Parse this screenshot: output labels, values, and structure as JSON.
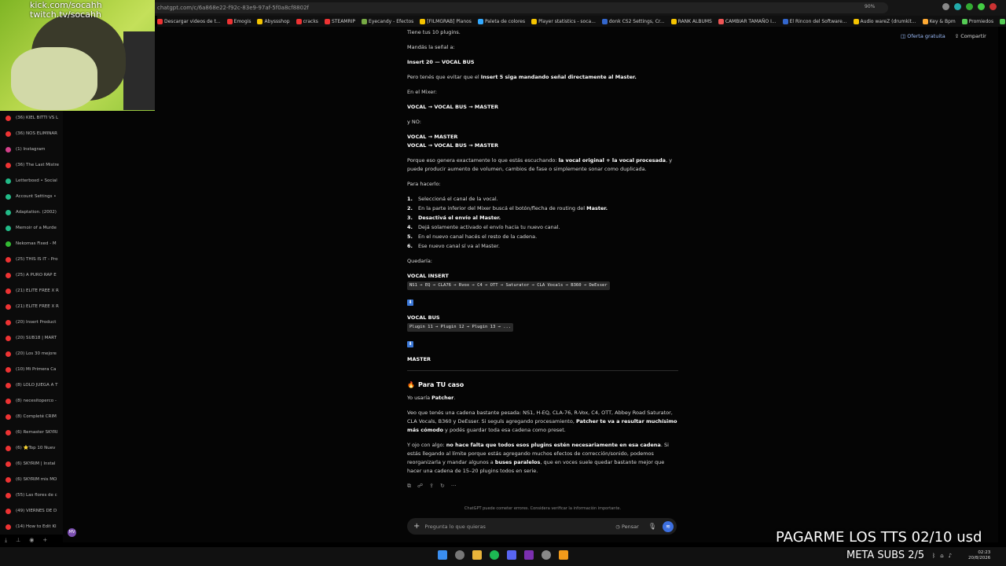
{
  "browser": {
    "url": "chatgpt.com/c/6a868e22-f92c-83e9-97af-5f0a8cf8802f",
    "zoom": "90%",
    "bookmarks": [
      {
        "label": "Descargar videos de t...",
        "color": "#e33"
      },
      {
        "label": "Emogis",
        "color": "#e33"
      },
      {
        "label": "Abyssshop",
        "color": "#f5c400"
      },
      {
        "label": "cracks",
        "color": "#e33"
      },
      {
        "label": "STEAMRIP",
        "color": "#e33"
      },
      {
        "label": "Eyecandy - Efectos",
        "color": "#7a4"
      },
      {
        "label": "[FILMGRAB] Planos",
        "color": "#f5c400"
      },
      {
        "label": "Paleta de colores",
        "color": "#3af"
      },
      {
        "label": "Player statistics - soca...",
        "color": "#f5c400"
      },
      {
        "label": "donk CS2 Settings, Cr...",
        "color": "#36c"
      },
      {
        "label": "RANK ALBUMS",
        "color": "#f5c400"
      },
      {
        "label": "CAMBIAR TAMAÑO I...",
        "color": "#e55"
      },
      {
        "label": "El Rincon del Software...",
        "color": "#36c"
      },
      {
        "label": "Audio wareZ (drumkit...",
        "color": "#f5c400"
      },
      {
        "label": "Key & Bpm",
        "color": "#fa3"
      },
      {
        "label": "Promiedos",
        "color": "#5c5"
      },
      {
        "label": "botkick",
        "color": "#5c5"
      },
      {
        "label": "CRACKS VSTS",
        "color": "#f5c400"
      }
    ]
  },
  "stream": {
    "kick": "kick.com/socahh",
    "twitch": "twitch.tv/socahh",
    "overlay_tts": "PAGARME LOS TTS 02/10 usd",
    "overlay_subs": "META SUBS 2/5"
  },
  "sidebar": {
    "items": [
      {
        "label": "(36) KIEL BITTI VS L",
        "color": "#e33"
      },
      {
        "label": "(36) NOS ELIMINAR",
        "color": "#e33"
      },
      {
        "label": "(1) Instagram",
        "color": "#d4408a"
      },
      {
        "label": "(36) The Last Mistre",
        "color": "#e33"
      },
      {
        "label": "Letterboxd • Social",
        "color": "#2b8"
      },
      {
        "label": "Account Settings • ",
        "color": "#2b8"
      },
      {
        "label": "Adaptation. (2002)",
        "color": "#2b8"
      },
      {
        "label": "Memoir of a Murde",
        "color": "#2b8"
      },
      {
        "label": "Nekomas Fixed - M",
        "color": "#3b3"
      },
      {
        "label": "(25) THIS IS IT - Pro",
        "color": "#e33"
      },
      {
        "label": "(25) A PURO RAP E",
        "color": "#e33"
      },
      {
        "label": "(21) ELITE FREE X R",
        "color": "#e33"
      },
      {
        "label": "(21) ELITE FREE X R",
        "color": "#e33"
      },
      {
        "label": "(20) Insert Product",
        "color": "#e33"
      },
      {
        "label": "(20) SUB18 | MART",
        "color": "#e33"
      },
      {
        "label": "(20) Los 30 mejore",
        "color": "#e33"
      },
      {
        "label": "(10) Mi Primera Ca",
        "color": "#e33"
      },
      {
        "label": "(8) LOLO JUEGA A T",
        "color": "#e33"
      },
      {
        "label": "(8) necesitoperco -",
        "color": "#e33"
      },
      {
        "label": "(8) Completé CRIM",
        "color": "#e33"
      },
      {
        "label": "(6) Remaster SKYRI",
        "color": "#e33"
      },
      {
        "label": "(6) ⭐Top 10 Nuev",
        "color": "#e33"
      },
      {
        "label": "(6) SKYRIM | Instal",
        "color": "#e33"
      },
      {
        "label": "(6) SKYRIM mis MO",
        "color": "#e33"
      },
      {
        "label": "(55) Las flores de c",
        "color": "#e33"
      },
      {
        "label": "(49) VIERNES DE D",
        "color": "#e33"
      },
      {
        "label": "(14) How to Edit KI",
        "color": "#e33"
      }
    ],
    "avatar": "MV"
  },
  "header": {
    "offer": "Oferta gratuita",
    "share": "Compartir"
  },
  "chat": {
    "p1": "Tiene tus 10 plugins.",
    "p2": "Mandás la señal a:",
    "p3": "Insert 20 — VOCAL BUS",
    "p4a": "Pero tenés que evitar que el ",
    "p4b": "Insert 5 siga mandando señal directamente al Master.",
    "p5": "En el Mixer:",
    "p6": "VOCAL → VOCAL BUS → MASTER",
    "p7": "y NO:",
    "p8a": "VOCAL → MASTER",
    "p8b": "VOCAL → VOCAL BUS → MASTER",
    "p9a": "Porque eso genera exactamente lo que estás escuchando: ",
    "p9b": "la vocal original + la vocal procesada",
    "p9c": ", y puede producir aumento de volumen, cambios de fase o simplemente sonar como duplicada.",
    "p10": "Para hacerlo:",
    "steps": [
      {
        "n": "1.",
        "a": "Seleccioná el canal de la vocal.",
        "b": ""
      },
      {
        "n": "2.",
        "a": "En la parte inferior del Mixer buscá el botón/flecha de routing del ",
        "b": "Master."
      },
      {
        "n": "3.",
        "a": "",
        "b": "Desactivá el envío al Master."
      },
      {
        "n": "4.",
        "a": "Dejá solamente activado el envío hacia tu nuevo canal.",
        "b": ""
      },
      {
        "n": "5.",
        "a": "En el nuevo canal hacés el resto de la cadena.",
        "b": ""
      },
      {
        "n": "6.",
        "a": "Ese nuevo canal sí va al Master.",
        "b": ""
      }
    ],
    "p11": "Quedaría:",
    "vi_title": "VOCAL INSERT",
    "vi_chain": "NS1 → EQ → CLA76 → Rvox → C4 → OTT → Saturator → CLA Vocals → B360 → DeEsser",
    "arrow": "⬇",
    "vb_title": "VOCAL BUS",
    "vb_chain": "Plugin 11 → Plugin 12 → Plugin 13 → ...",
    "master": "MASTER",
    "case_icon": "🔥",
    "case_title": "Para TU caso",
    "p12a": "Yo usaría ",
    "p12b": "Patcher",
    "p12c": ".",
    "p13a": "Veo que tenés una cadena bastante pesada: NS1, H-EQ, CLA-76, R-Vox, C4, OTT, Abbey Road Saturator, CLA Vocals, B360 y DeEsser. Si seguís agregando procesamiento, ",
    "p13b": "Patcher te va a resultar muchísimo más cómodo",
    "p13c": " y podés guardar toda esa cadena como preset.",
    "p14a": "Y ojo con algo: ",
    "p14b": "no hace falta que todos esos plugins estén necesariamente en esa cadena",
    "p14c": ". Si estás llegando al límite porque estás agregando muchos efectos de corrección/sonido, podemos reorganizarla y mandar algunos a ",
    "p14d": "buses paralelos",
    "p14e": ", que en voces suele quedar bastante mejor que hacer una cadena de 15–20 plugins todos en serie.",
    "disclaimer": "ChatGPT puede cometer errores. Considera verificar la información importante.",
    "placeholder": "Pregunta lo que quieras",
    "pensar": "Pensar"
  },
  "clock": {
    "time": "02:23",
    "date": "20/8/2026"
  }
}
